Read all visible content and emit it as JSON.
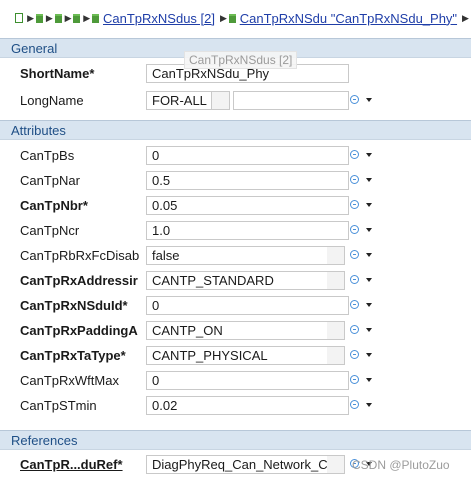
{
  "breadcrumb": {
    "link1": "CanTpRxNSdus [2]",
    "link2": "CanTpRxNSdu \"CanTpRxNSdu_Phy\""
  },
  "tooltip": "CanTpRxNSdus [2]",
  "sections": {
    "general": "General",
    "attributes": "Attributes",
    "references": "References"
  },
  "general": {
    "short_name_label": "ShortName*",
    "short_name_value": "CanTpRxNSdu_Phy",
    "long_name_label": "LongName",
    "long_name_lang": "FOR-ALL",
    "long_name_value": ""
  },
  "attributes": [
    {
      "label": "CanTpBs",
      "value": "0",
      "bold": false
    },
    {
      "label": "CanTpNar",
      "value": "0.5",
      "bold": false
    },
    {
      "label": "CanTpNbr*",
      "value": "0.05",
      "bold": true
    },
    {
      "label": "CanTpNcr",
      "value": "1.0",
      "bold": false
    },
    {
      "label": "CanTpRbRxFcDisab",
      "value": "false",
      "bold": false
    },
    {
      "label": "CanTpRxAddressir",
      "value": "CANTP_STANDARD",
      "bold": true
    },
    {
      "label": "CanTpRxNSduId*",
      "value": "0",
      "bold": true
    },
    {
      "label": "CanTpRxPaddingA",
      "value": "CANTP_ON",
      "bold": true
    },
    {
      "label": "CanTpRxTaType*",
      "value": "CANTP_PHYSICAL",
      "bold": true
    },
    {
      "label": "CanTpRxWftMax",
      "value": "0",
      "bold": false
    },
    {
      "label": "CanTpSTmin",
      "value": "0.02",
      "bold": false
    }
  ],
  "references": {
    "label": "CanTpR...duRef*",
    "value": "DiagPhyReq_Can_Network_CA"
  },
  "watermark": "CSDN @PlutoZuo"
}
